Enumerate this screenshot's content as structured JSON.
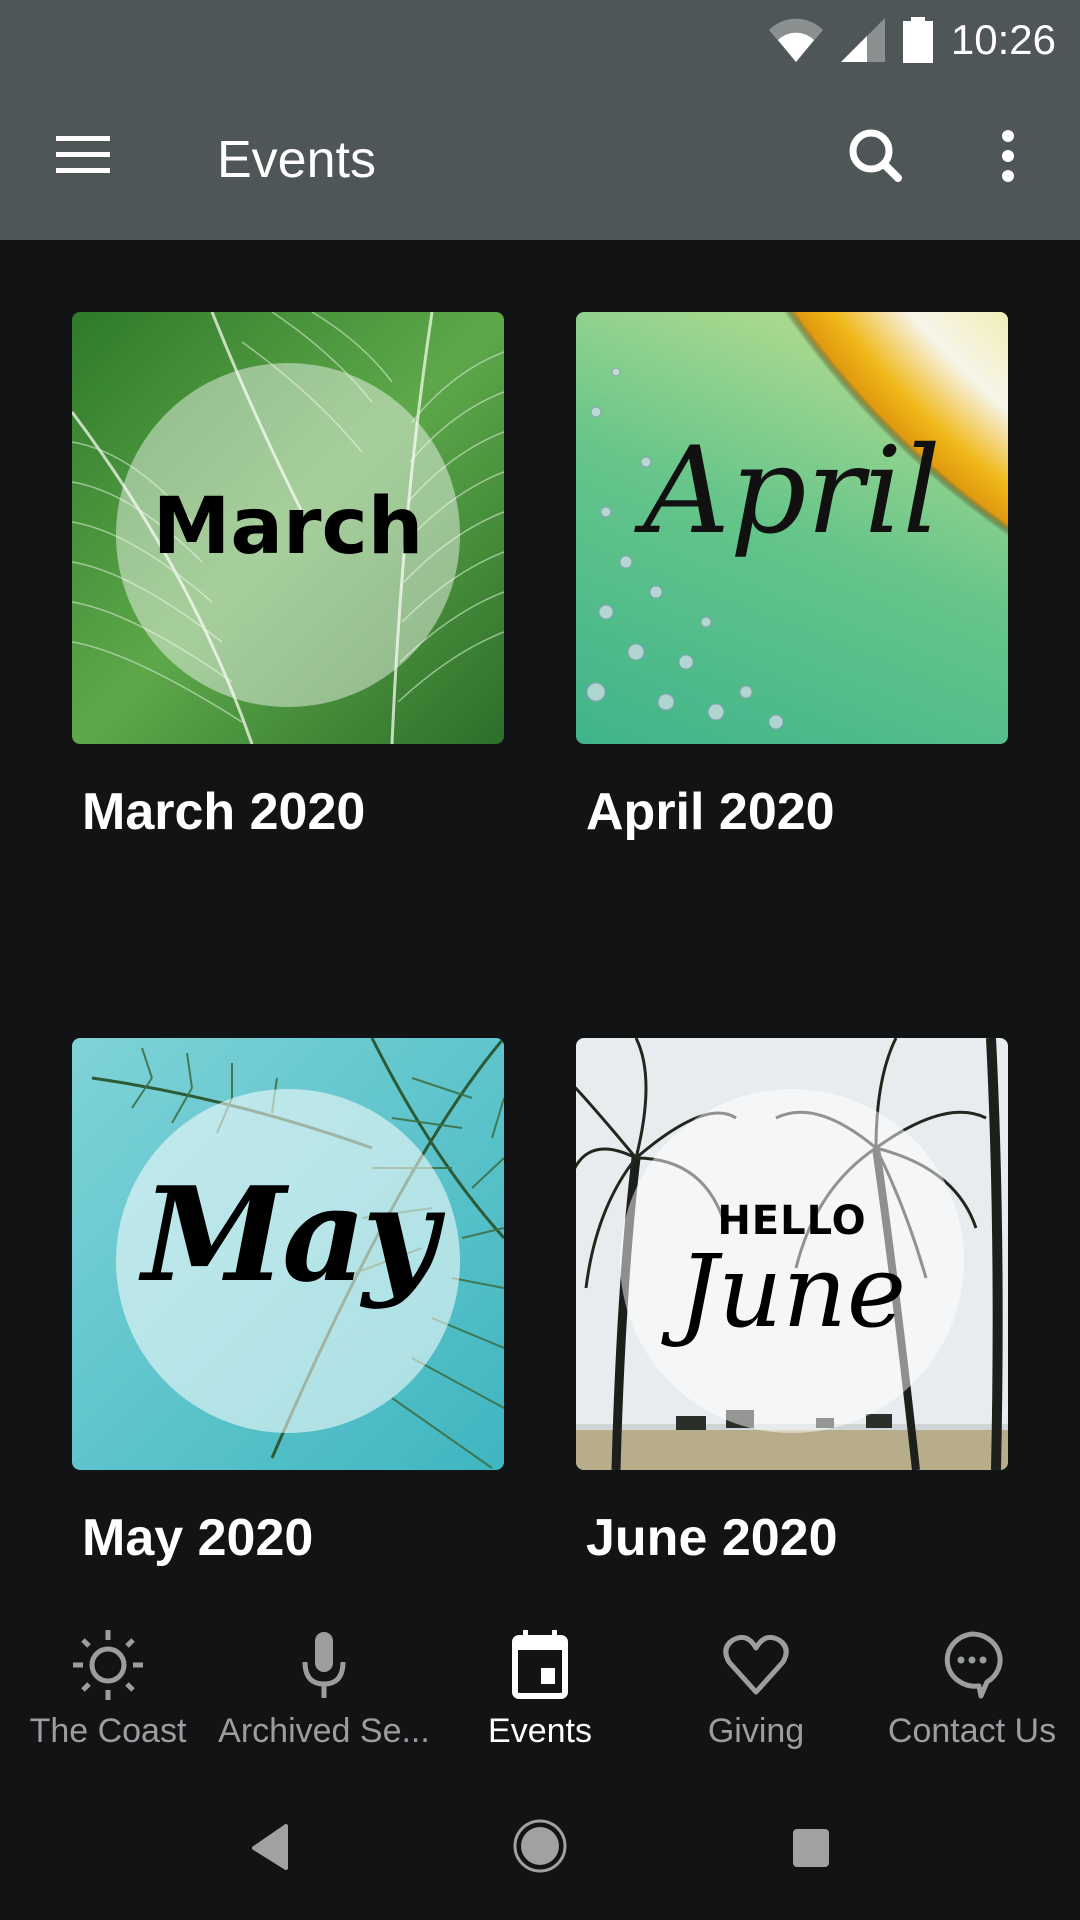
{
  "status_bar": {
    "time": "10:26",
    "icons": [
      "wifi-icon",
      "cellular-signal-icon",
      "battery-icon"
    ]
  },
  "app_bar": {
    "title": "Events",
    "menu_icon": "hamburger-menu-icon",
    "search_icon": "search-icon",
    "overflow_icon": "more-vert-icon"
  },
  "events": [
    {
      "title": "March 2020",
      "image_text": "March",
      "theme": "green-leaves"
    },
    {
      "title": "April 2020",
      "image_text": "April",
      "theme": "lemon-slice"
    },
    {
      "title": "May 2020",
      "image_text": "May",
      "theme": "palm-pool"
    },
    {
      "title": "June 2020",
      "image_text_top": "HELLO",
      "image_text": "June",
      "theme": "palm-beach"
    }
  ],
  "bottom_nav": {
    "items": [
      {
        "label": "The Coast",
        "icon": "sun-icon",
        "active": false
      },
      {
        "label": "Archived Se...",
        "icon": "microphone-icon",
        "active": false
      },
      {
        "label": "Events",
        "icon": "calendar-icon",
        "active": true
      },
      {
        "label": "Giving",
        "icon": "heart-icon",
        "active": false
      },
      {
        "label": "Contact Us",
        "icon": "chat-bubble-icon",
        "active": false
      }
    ]
  },
  "system_nav": {
    "back": "back-icon",
    "home": "home-icon",
    "recents": "recents-icon"
  },
  "colors": {
    "app_bar": "#4f5658",
    "background": "#121315",
    "nav_inactive": "#9b9d9f",
    "nav_active": "#ffffff"
  }
}
